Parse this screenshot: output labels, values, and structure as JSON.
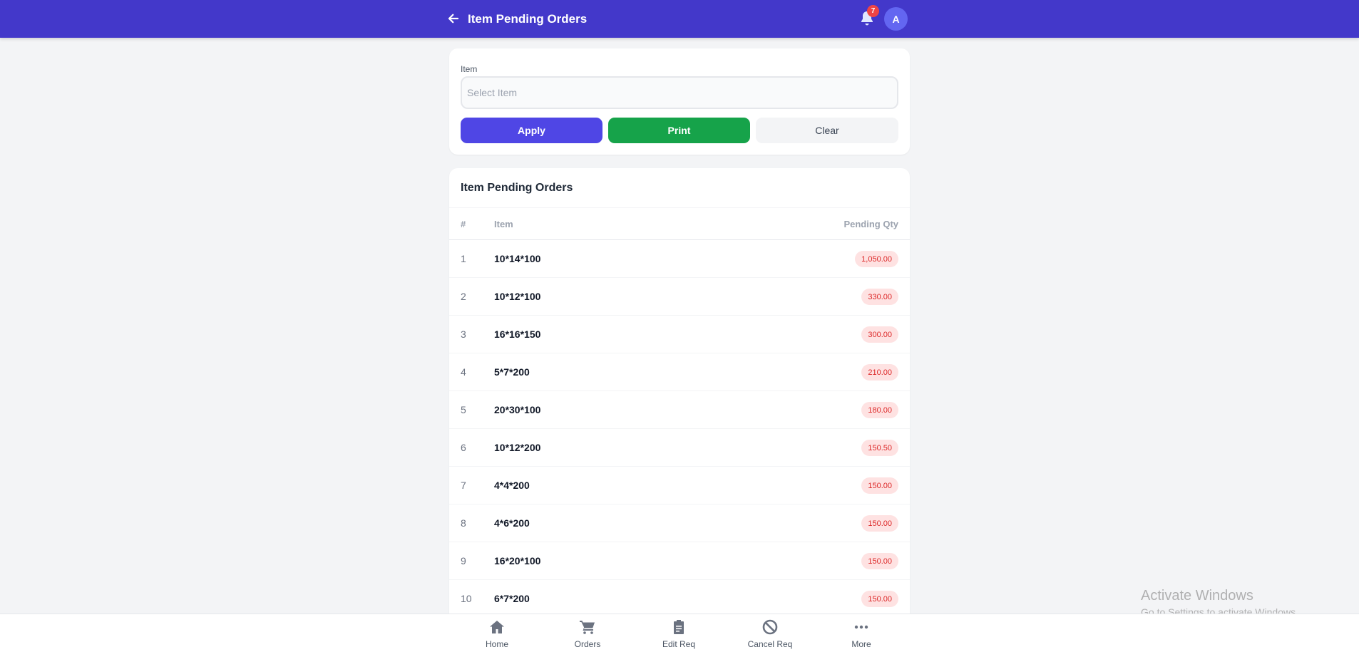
{
  "header": {
    "title": "Item Pending Orders",
    "notification_count": "7",
    "avatar_initial": "A",
    "icons": {
      "back": "arrow-left-icon",
      "bell": "bell-icon"
    }
  },
  "filter": {
    "item_label": "Item",
    "item_placeholder": "Select Item",
    "apply_label": "Apply",
    "print_label": "Print",
    "clear_label": "Clear"
  },
  "table": {
    "title": "Item Pending Orders",
    "columns": [
      "#",
      "Item",
      "Pending Qty"
    ],
    "rows": [
      {
        "idx": "1",
        "item": "10*14*100",
        "qty": "1,050.00"
      },
      {
        "idx": "2",
        "item": "10*12*100",
        "qty": "330.00"
      },
      {
        "idx": "3",
        "item": "16*16*150",
        "qty": "300.00"
      },
      {
        "idx": "4",
        "item": "5*7*200",
        "qty": "210.00"
      },
      {
        "idx": "5",
        "item": "20*30*100",
        "qty": "180.00"
      },
      {
        "idx": "6",
        "item": "10*12*200",
        "qty": "150.50"
      },
      {
        "idx": "7",
        "item": "4*4*200",
        "qty": "150.00"
      },
      {
        "idx": "8",
        "item": "4*6*200",
        "qty": "150.00"
      },
      {
        "idx": "9",
        "item": "16*20*100",
        "qty": "150.00"
      },
      {
        "idx": "10",
        "item": "6*7*200",
        "qty": "150.00"
      }
    ]
  },
  "bottom_nav": [
    {
      "label": "Home",
      "icon": "home-icon"
    },
    {
      "label": "Orders",
      "icon": "cart-icon"
    },
    {
      "label": "Edit Req",
      "icon": "clipboard-icon"
    },
    {
      "label": "Cancel Req",
      "icon": "ban-icon"
    },
    {
      "label": "More",
      "icon": "ellipsis-icon"
    }
  ],
  "watermark": {
    "title": "Activate Windows",
    "subtitle": "Go to Settings to activate Windows."
  },
  "colors": {
    "primary": "#4338ca",
    "apply": "#4f46e5",
    "print": "#16a34a",
    "badge_bg": "#fee2e2",
    "badge_text": "#dc2626",
    "notification": "#ef4444"
  }
}
